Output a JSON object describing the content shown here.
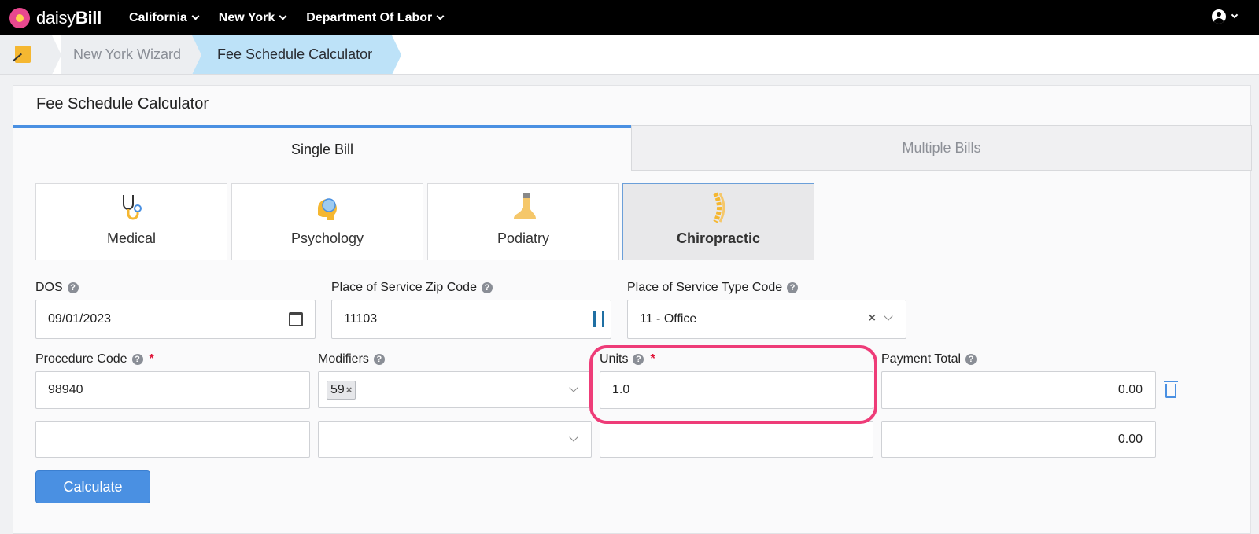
{
  "topbar": {
    "logo_prefix": "daisy",
    "logo_suffix": "Bill",
    "nav": [
      "California",
      "New York",
      "Department Of Labor"
    ]
  },
  "breadcrumb": {
    "wizard": "New York Wizard",
    "current": "Fee Schedule Calculator"
  },
  "panel": {
    "title": "Fee Schedule Calculator",
    "tabs": [
      "Single Bill",
      "Multiple Bills"
    ],
    "specialties": [
      {
        "label": "Medical",
        "icon": "stethoscope-icon"
      },
      {
        "label": "Psychology",
        "icon": "brain-icon"
      },
      {
        "label": "Podiatry",
        "icon": "foot-icon"
      },
      {
        "label": "Chiropractic",
        "icon": "spine-icon",
        "selected": true
      }
    ]
  },
  "form": {
    "dos_label": "DOS",
    "dos_value": "09/01/2023",
    "zip_label": "Place of Service Zip Code",
    "zip_value": "11103",
    "pos_label": "Place of Service Type Code",
    "pos_value": "11 - Office",
    "procedure_label": "Procedure Code",
    "modifiers_label": "Modifiers",
    "units_label": "Units",
    "payment_label": "Payment Total",
    "rows": [
      {
        "procedure": "98940",
        "modifier": "59",
        "units": "1.0",
        "payment": "0.00"
      },
      {
        "procedure": "",
        "modifier": "",
        "units": "",
        "payment": "0.00"
      }
    ],
    "calculate_label": "Calculate"
  },
  "colors": {
    "accent": "#4a90e2",
    "highlight": "#ee3c78",
    "breadcrumb_active": "#bde2f8"
  }
}
